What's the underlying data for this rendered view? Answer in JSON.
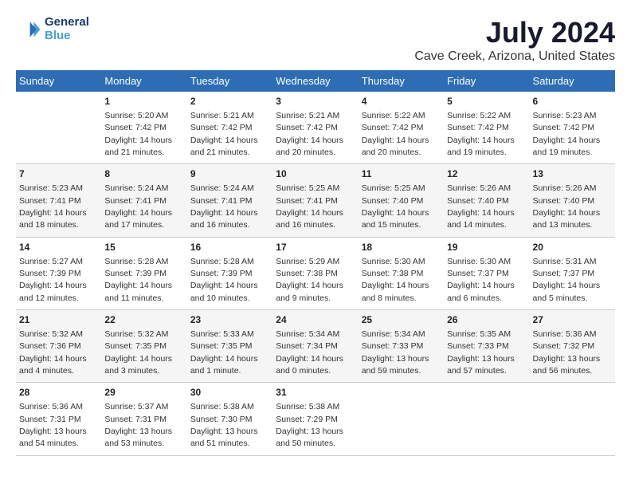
{
  "logo": {
    "line1": "General",
    "line2": "Blue"
  },
  "title": "July 2024",
  "subtitle": "Cave Creek, Arizona, United States",
  "days_of_week": [
    "Sunday",
    "Monday",
    "Tuesday",
    "Wednesday",
    "Thursday",
    "Friday",
    "Saturday"
  ],
  "weeks": [
    [
      {
        "day": "",
        "info": ""
      },
      {
        "day": "1",
        "info": "Sunrise: 5:20 AM\nSunset: 7:42 PM\nDaylight: 14 hours\nand 21 minutes."
      },
      {
        "day": "2",
        "info": "Sunrise: 5:21 AM\nSunset: 7:42 PM\nDaylight: 14 hours\nand 21 minutes."
      },
      {
        "day": "3",
        "info": "Sunrise: 5:21 AM\nSunset: 7:42 PM\nDaylight: 14 hours\nand 20 minutes."
      },
      {
        "day": "4",
        "info": "Sunrise: 5:22 AM\nSunset: 7:42 PM\nDaylight: 14 hours\nand 20 minutes."
      },
      {
        "day": "5",
        "info": "Sunrise: 5:22 AM\nSunset: 7:42 PM\nDaylight: 14 hours\nand 19 minutes."
      },
      {
        "day": "6",
        "info": "Sunrise: 5:23 AM\nSunset: 7:42 PM\nDaylight: 14 hours\nand 19 minutes."
      }
    ],
    [
      {
        "day": "7",
        "info": "Sunrise: 5:23 AM\nSunset: 7:41 PM\nDaylight: 14 hours\nand 18 minutes."
      },
      {
        "day": "8",
        "info": "Sunrise: 5:24 AM\nSunset: 7:41 PM\nDaylight: 14 hours\nand 17 minutes."
      },
      {
        "day": "9",
        "info": "Sunrise: 5:24 AM\nSunset: 7:41 PM\nDaylight: 14 hours\nand 16 minutes."
      },
      {
        "day": "10",
        "info": "Sunrise: 5:25 AM\nSunset: 7:41 PM\nDaylight: 14 hours\nand 16 minutes."
      },
      {
        "day": "11",
        "info": "Sunrise: 5:25 AM\nSunset: 7:40 PM\nDaylight: 14 hours\nand 15 minutes."
      },
      {
        "day": "12",
        "info": "Sunrise: 5:26 AM\nSunset: 7:40 PM\nDaylight: 14 hours\nand 14 minutes."
      },
      {
        "day": "13",
        "info": "Sunrise: 5:26 AM\nSunset: 7:40 PM\nDaylight: 14 hours\nand 13 minutes."
      }
    ],
    [
      {
        "day": "14",
        "info": "Sunrise: 5:27 AM\nSunset: 7:39 PM\nDaylight: 14 hours\nand 12 minutes."
      },
      {
        "day": "15",
        "info": "Sunrise: 5:28 AM\nSunset: 7:39 PM\nDaylight: 14 hours\nand 11 minutes."
      },
      {
        "day": "16",
        "info": "Sunrise: 5:28 AM\nSunset: 7:39 PM\nDaylight: 14 hours\nand 10 minutes."
      },
      {
        "day": "17",
        "info": "Sunrise: 5:29 AM\nSunset: 7:38 PM\nDaylight: 14 hours\nand 9 minutes."
      },
      {
        "day": "18",
        "info": "Sunrise: 5:30 AM\nSunset: 7:38 PM\nDaylight: 14 hours\nand 8 minutes."
      },
      {
        "day": "19",
        "info": "Sunrise: 5:30 AM\nSunset: 7:37 PM\nDaylight: 14 hours\nand 6 minutes."
      },
      {
        "day": "20",
        "info": "Sunrise: 5:31 AM\nSunset: 7:37 PM\nDaylight: 14 hours\nand 5 minutes."
      }
    ],
    [
      {
        "day": "21",
        "info": "Sunrise: 5:32 AM\nSunset: 7:36 PM\nDaylight: 14 hours\nand 4 minutes."
      },
      {
        "day": "22",
        "info": "Sunrise: 5:32 AM\nSunset: 7:35 PM\nDaylight: 14 hours\nand 3 minutes."
      },
      {
        "day": "23",
        "info": "Sunrise: 5:33 AM\nSunset: 7:35 PM\nDaylight: 14 hours\nand 1 minute."
      },
      {
        "day": "24",
        "info": "Sunrise: 5:34 AM\nSunset: 7:34 PM\nDaylight: 14 hours\nand 0 minutes."
      },
      {
        "day": "25",
        "info": "Sunrise: 5:34 AM\nSunset: 7:33 PM\nDaylight: 13 hours\nand 59 minutes."
      },
      {
        "day": "26",
        "info": "Sunrise: 5:35 AM\nSunset: 7:33 PM\nDaylight: 13 hours\nand 57 minutes."
      },
      {
        "day": "27",
        "info": "Sunrise: 5:36 AM\nSunset: 7:32 PM\nDaylight: 13 hours\nand 56 minutes."
      }
    ],
    [
      {
        "day": "28",
        "info": "Sunrise: 5:36 AM\nSunset: 7:31 PM\nDaylight: 13 hours\nand 54 minutes."
      },
      {
        "day": "29",
        "info": "Sunrise: 5:37 AM\nSunset: 7:31 PM\nDaylight: 13 hours\nand 53 minutes."
      },
      {
        "day": "30",
        "info": "Sunrise: 5:38 AM\nSunset: 7:30 PM\nDaylight: 13 hours\nand 51 minutes."
      },
      {
        "day": "31",
        "info": "Sunrise: 5:38 AM\nSunset: 7:29 PM\nDaylight: 13 hours\nand 50 minutes."
      },
      {
        "day": "",
        "info": ""
      },
      {
        "day": "",
        "info": ""
      },
      {
        "day": "",
        "info": ""
      }
    ]
  ]
}
